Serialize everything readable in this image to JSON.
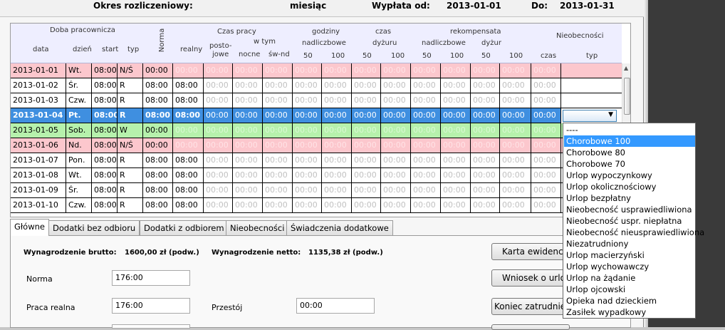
{
  "summary": {
    "period_label": "Okres rozliczeniowy:",
    "period_value": "miesiąc",
    "payout_label": "Wypłata od:",
    "payout_from": "2013-01-01",
    "to_label": "Do:",
    "payout_to": "2013-01-31"
  },
  "grid_header": {
    "group_day": "Doba pracownicza",
    "col_date": "data",
    "col_day": "dzień",
    "col_start": "start",
    "col_type": "typ",
    "col_norma": "Norma",
    "group_worktime": "Czas pracy",
    "col_real": "realny",
    "col_idle_a": "posto-",
    "col_idle_b": "jowe",
    "sub_incl": "w tym",
    "col_night": "nocne",
    "col_holiday": "św-nd",
    "group_hours": "godziny",
    "sub_overtime": "nadliczbowe",
    "col_50": "50",
    "col_100": "100",
    "group_time": "czas",
    "sub_duty": "dyżuru",
    "group_comp": "rekompensata",
    "sub_comp_overtime": "nadliczbowe",
    "sub_comp_duty": "dyżur",
    "col_czas": "czas",
    "group_absence": "Nieobecności",
    "col_absence_type": "typ"
  },
  "rows": [
    {
      "date": "2013-01-01",
      "day": "Wt.",
      "start": "08:00",
      "type": "N/Ś",
      "norma": "00:00",
      "real": "00:00",
      "style": "weekend-ns",
      "vals": [
        "00:00",
        "00:00",
        "00:00",
        "00:00",
        "00:00",
        "00:00",
        "00:00",
        "00:00",
        "00:00",
        "00:00",
        "00:00",
        "00:00"
      ]
    },
    {
      "date": "2013-01-02",
      "day": "Śr.",
      "start": "08:00",
      "type": "R",
      "norma": "08:00",
      "real": "08:00",
      "style": "normal",
      "vals": [
        "00:00",
        "00:00",
        "00:00",
        "00:00",
        "00:00",
        "00:00",
        "00:00",
        "00:00",
        "00:00",
        "00:00",
        "00:00",
        "00:00"
      ]
    },
    {
      "date": "2013-01-03",
      "day": "Czw.",
      "start": "08:00",
      "type": "R",
      "norma": "08:00",
      "real": "08:00",
      "style": "normal",
      "vals": [
        "00:00",
        "00:00",
        "00:00",
        "00:00",
        "00:00",
        "00:00",
        "00:00",
        "00:00",
        "00:00",
        "00:00",
        "00:00",
        "00:00"
      ]
    },
    {
      "date": "2013-01-04",
      "day": "Pt.",
      "start": "08:00",
      "type": "R",
      "norma": "08:00",
      "real": "08:00",
      "style": "selected",
      "vals": [
        "00:00",
        "00:00",
        "00:00",
        "00:00",
        "00:00",
        "00:00",
        "00:00",
        "00:00",
        "00:00",
        "00:00",
        "00:00",
        "00:00"
      ]
    },
    {
      "date": "2013-01-05",
      "day": "Sob.",
      "start": "08:00",
      "type": "W",
      "norma": "00:00",
      "real": "00:00",
      "style": "free",
      "vals": [
        "00:00",
        "00:00",
        "00:00",
        "00:00",
        "00:00",
        "00:00",
        "00:00",
        "00:00",
        "00:00",
        "00:00",
        "00:00",
        "00:00"
      ]
    },
    {
      "date": "2013-01-06",
      "day": "Nd.",
      "start": "08:00",
      "type": "N/Ś",
      "norma": "00:00",
      "real": "00:00",
      "style": "weekend-ns",
      "vals": [
        "00:00",
        "00:00",
        "00:00",
        "00:00",
        "00:00",
        "00:00",
        "00:00",
        "00:00",
        "00:00",
        "00:00",
        "00:00",
        "00:00"
      ]
    },
    {
      "date": "2013-01-07",
      "day": "Pon.",
      "start": "08:00",
      "type": "R",
      "norma": "08:00",
      "real": "08:00",
      "style": "normal",
      "vals": [
        "00:00",
        "00:00",
        "00:00",
        "00:00",
        "00:00",
        "00:00",
        "00:00",
        "00:00",
        "00:00",
        "00:00",
        "00:00",
        "00:00"
      ]
    },
    {
      "date": "2013-01-08",
      "day": "Wt.",
      "start": "08:00",
      "type": "R",
      "norma": "08:00",
      "real": "08:00",
      "style": "normal",
      "vals": [
        "00:00",
        "00:00",
        "00:00",
        "00:00",
        "00:00",
        "00:00",
        "00:00",
        "00:00",
        "00:00",
        "00:00",
        "00:00",
        "00:00"
      ]
    },
    {
      "date": "2013-01-09",
      "day": "Śr.",
      "start": "08:00",
      "type": "R",
      "norma": "08:00",
      "real": "08:00",
      "style": "normal",
      "vals": [
        "00:00",
        "00:00",
        "00:00",
        "00:00",
        "00:00",
        "00:00",
        "00:00",
        "00:00",
        "00:00",
        "00:00",
        "00:00",
        "00:00"
      ]
    },
    {
      "date": "2013-01-10",
      "day": "Czw.",
      "start": "08:00",
      "type": "R",
      "norma": "08:00",
      "real": "08:00",
      "style": "normal",
      "vals": [
        "00:00",
        "00:00",
        "00:00",
        "00:00",
        "00:00",
        "00:00",
        "00:00",
        "00:00",
        "00:00",
        "00:00",
        "00:00",
        "00:00"
      ]
    }
  ],
  "tabs": [
    "Główne",
    "Dodatki bez odbioru",
    "Dodatki z odbiorem",
    "Nieobecności",
    "Świadczenia dodatkowe"
  ],
  "main_tab": {
    "gross_label": "Wynagrodzenie brutto:",
    "gross_value": "1600,00 zł (podw.)",
    "net_label": "Wynagrodzenie netto:",
    "net_value": "1135,38 zł (podw.)",
    "norma_label": "Norma",
    "norma_value": "176:00",
    "real_label": "Praca realna",
    "real_value": "176:00",
    "idle_label": "Przestój",
    "idle_value": "00:00"
  },
  "actions": {
    "records_card": "Karta ewidencji",
    "leave_request": "Wniosek o urlop",
    "end_employment": "Koniec zatrudnienia"
  },
  "absence_options": [
    "----",
    "Chorobowe 100",
    "Chorobowe 80",
    "Chorobowe 70",
    "Urlop wypoczynkowy",
    "Urlop okolicznościowy",
    "Urlop bezpłatny",
    "Nieobecność usprawiedliwiona",
    "Nieobecność uspr. niepłatna",
    "Nieobecność nieusprawiedliwiona",
    "Niezatrudniony",
    "Urlop macierzyński",
    "Urlop wychowawczy",
    "Urlop na żądanie",
    "Urlop ojcowski",
    "Opieka nad dzieckiem",
    "Zasiłek wypadkowy"
  ],
  "absence_highlighted": "Chorobowe 100",
  "colors": {
    "holiday_row": "#fcc7cd",
    "free_row": "#b6f1ac",
    "selected_row": "#3f8fe0",
    "header_bg": "#eeeeff",
    "dropdown_highlight": "#3399ff"
  }
}
